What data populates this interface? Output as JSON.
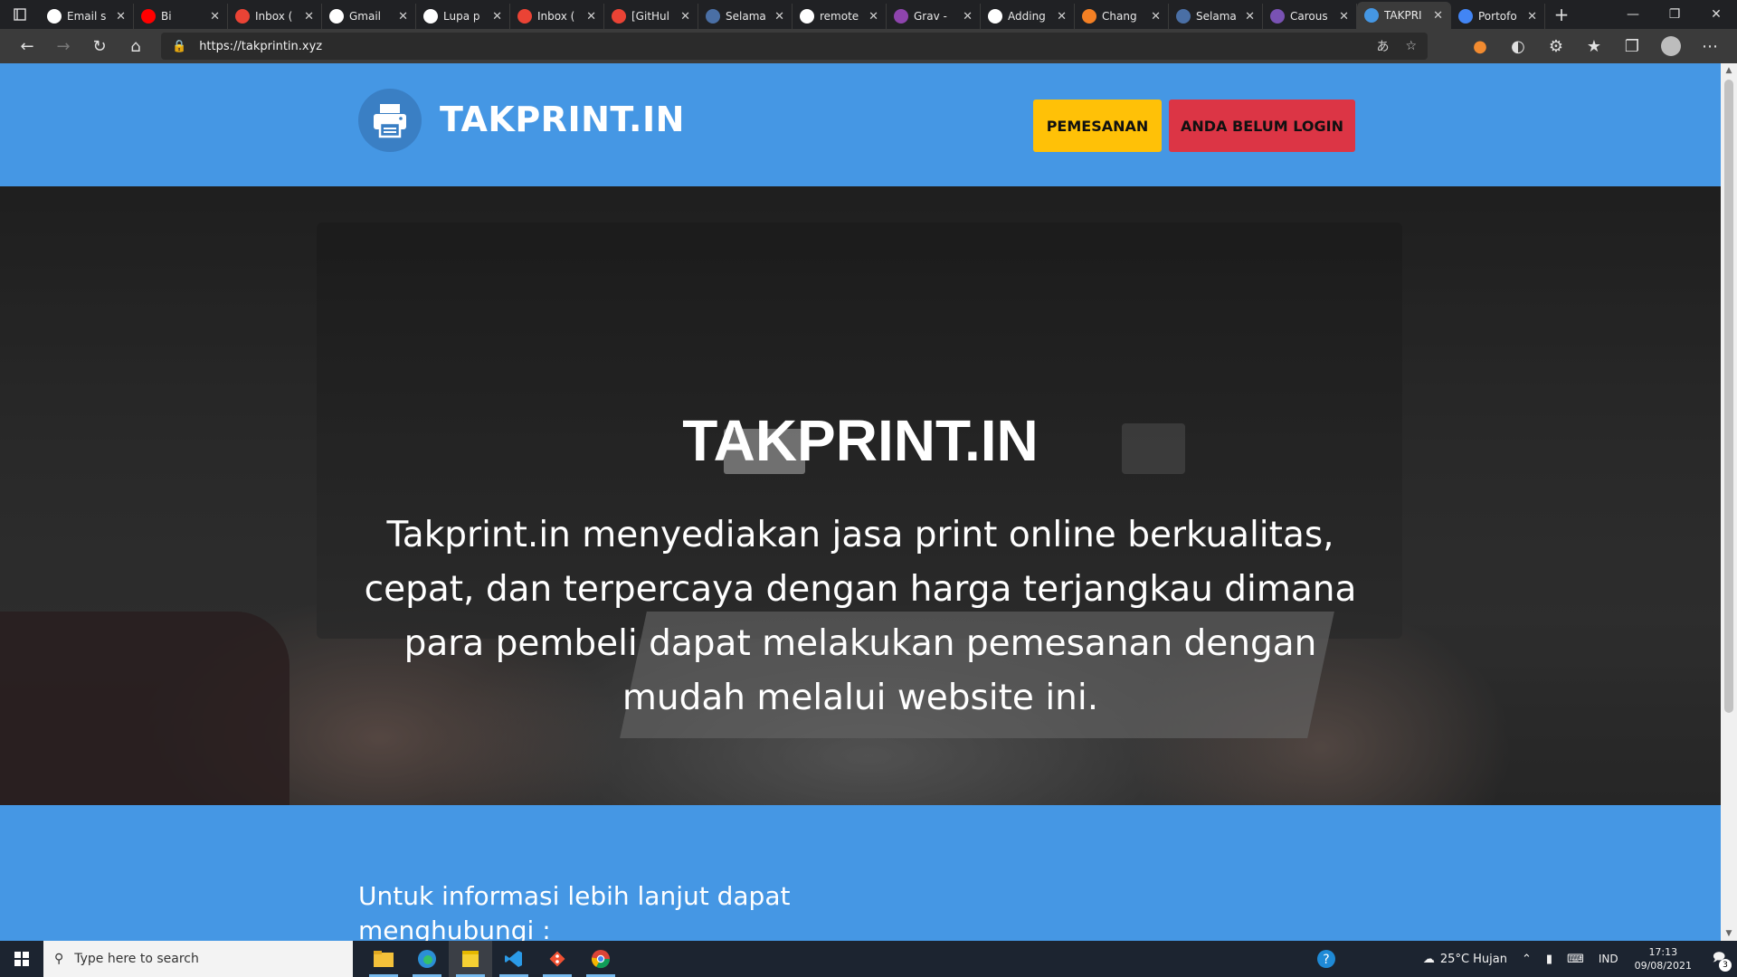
{
  "browser": {
    "tabs": [
      {
        "label": "Email s",
        "icon": "github-icon",
        "color": "#ffffff"
      },
      {
        "label": "Bi",
        "icon": "youtube-icon",
        "color": "#ff0000"
      },
      {
        "label": "Inbox (",
        "icon": "gmail-icon",
        "color": "#ea4335"
      },
      {
        "label": "Gmail",
        "icon": "google-icon",
        "color": "#ffffff"
      },
      {
        "label": "Lupa p",
        "icon": "google-icon",
        "color": "#ffffff"
      },
      {
        "label": "Inbox (",
        "icon": "gmail-icon",
        "color": "#ea4335"
      },
      {
        "label": "[GitHul",
        "icon": "gmail-icon",
        "color": "#ea4335"
      },
      {
        "label": "Selama",
        "icon": "person-icon",
        "color": "#4a6fa5"
      },
      {
        "label": "remote",
        "icon": "github-icon",
        "color": "#ffffff"
      },
      {
        "label": "Grav - ",
        "icon": "grav-icon",
        "color": "#8e44ad"
      },
      {
        "label": "Adding",
        "icon": "github-icon",
        "color": "#ffffff"
      },
      {
        "label": "Chang",
        "icon": "stack-icon",
        "color": "#f48024"
      },
      {
        "label": "Selama",
        "icon": "person-icon",
        "color": "#4a6fa5"
      },
      {
        "label": "Carous",
        "icon": "bootstrap-icon",
        "color": "#7952b3"
      },
      {
        "label": "TAKPRI",
        "icon": "printer-icon",
        "color": "#4597e4",
        "active": true
      },
      {
        "label": "Portofo",
        "icon": "document-icon",
        "color": "#4285f4"
      }
    ],
    "url": "https://takprintin.xyz"
  },
  "site": {
    "brand": "TAKPRINT.IN",
    "nav": {
      "order_button": "PEMESANAN",
      "login_button": "ANDA BELUM LOGIN"
    },
    "hero": {
      "title": "TAKPRINT.IN",
      "description": "Takprint.in menyediakan jasa print online berkualitas, cepat, dan terpercaya dengan harga terjangkau dimana para pembeli dapat melakukan pemesanan dengan mudah melalui website ini."
    },
    "info": {
      "text": "Untuk informasi lebih lanjut dapat menghubungi :"
    },
    "colors": {
      "primary": "#4597e4",
      "warning": "#ffc107",
      "danger": "#dc3545"
    }
  },
  "taskbar": {
    "search_placeholder": "Type here to search",
    "weather": "25°C  Hujan",
    "language": "IND",
    "time": "17:13",
    "date": "09/08/2021",
    "notification_count": "3"
  }
}
